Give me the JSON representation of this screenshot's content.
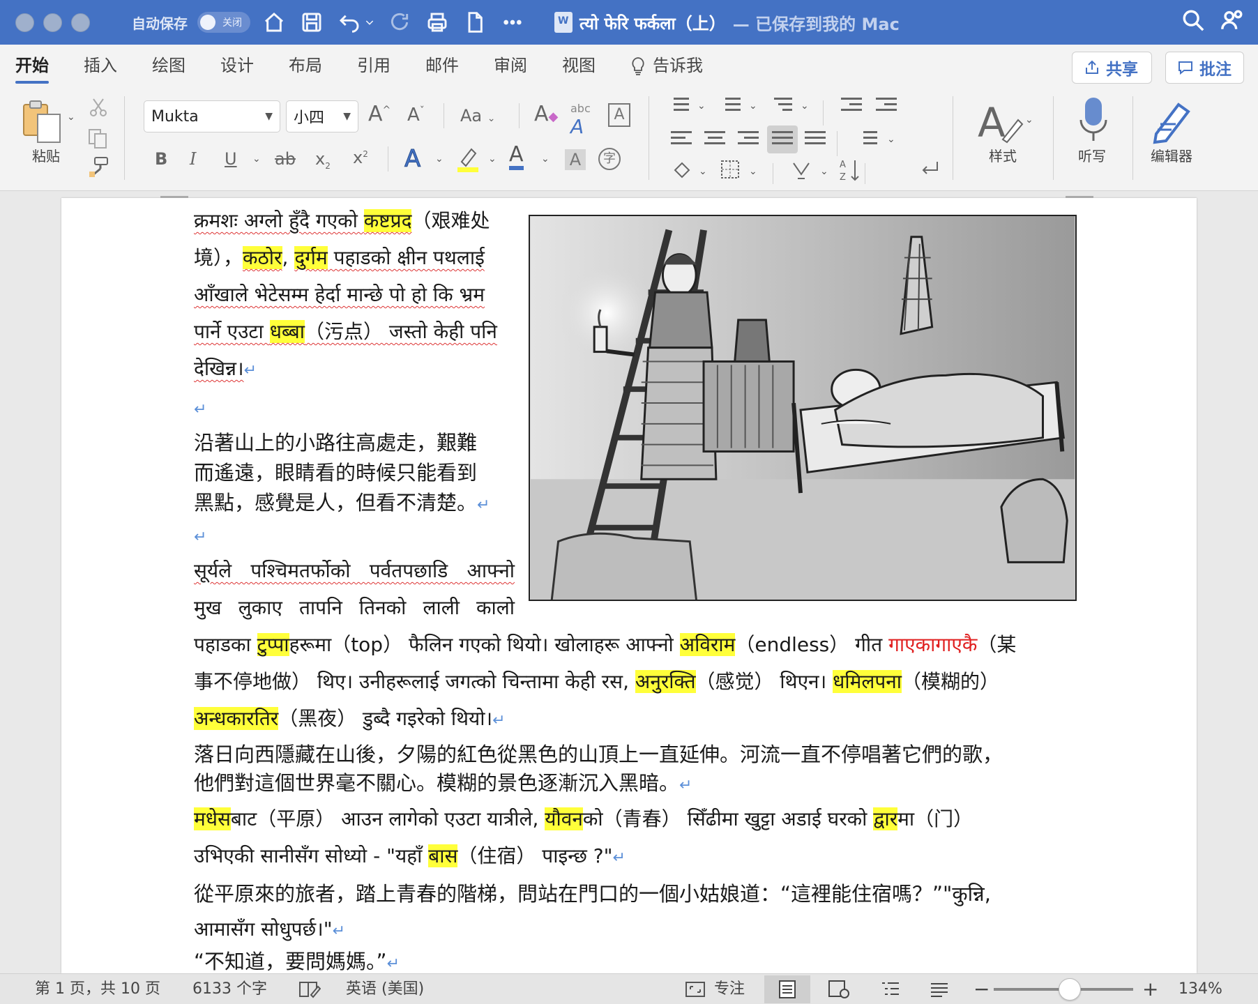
{
  "titlebar": {
    "autosave_label": "自动保存",
    "autosave_state": "关闭",
    "doc_name": "त्यो फेरि फर्कला（上）",
    "saved_status": "— 已保存到我的 Mac"
  },
  "tabs": [
    "开始",
    "插入",
    "绘图",
    "设计",
    "布局",
    "引用",
    "邮件",
    "审阅",
    "视图",
    "告诉我"
  ],
  "share_label": "共享",
  "comments_label": "批注",
  "ribbon": {
    "paste_label": "粘贴",
    "font_name": "Mukta",
    "font_size": "小四",
    "aa_label": "Aa",
    "abc_label": "abc",
    "styles_label": "样式",
    "dictate_label": "听写",
    "editor_label": "编辑器"
  },
  "doc": {
    "p1_l1_a": "क्रमशः अग्लो हुँदै गएको ",
    "p1_l1_hl": "कष्टप्रद",
    "p1_l1_b": "（艰难处",
    "p1_l2_a": "境），",
    "p1_l2_hl1": "कठोर",
    "p1_l2_sep": ", ",
    "p1_l2_hl2": "दुर्गम",
    "p1_l2_b": " पहाडको क्षीन पथलाई",
    "p1_l3": "आँखाले भेटेसम्म हेर्दा मान्छे पो हो कि भ्रम",
    "p1_l4_a": "पार्ने एउटा ",
    "p1_l4_hl": "धब्बा",
    "p1_l4_b": "（污点） जस्तो केही पनि",
    "p1_l5": "देखिन्न।",
    "c1_l1": "沿著山上的小路往高處走，艱難",
    "c1_l2": "而遙遠，眼睛看的時候只能看到",
    "c1_l3": "黑點，感覺是人，但看不清楚。",
    "p2_l1": "सूर्यले पश्चिमतर्फोको पर्वतपछाडि आफ्नो",
    "p2_l2": "मुख लुकाए तापनि तिनको लाली कालो",
    "p2_l3_a": "पहाडका ",
    "p2_l3_hl1": "टुप्पा",
    "p2_l3_b": "हरूमा（top） फैलिन गएको थियो। खोलाहरू आफ्नो ",
    "p2_l3_hl2": "अविराम",
    "p2_l3_c": "（endless） गीत ",
    "p2_l3_red": "गाएकागाएकै",
    "p2_l3_d": "（某",
    "p2_l4_a": "事不停地做） थिए। उनीहरूलाई जगत्को चिन्तामा केही रस, ",
    "p2_l4_hl1": "अनुरक्ति",
    "p2_l4_b": "（感觉） थिएन। ",
    "p2_l4_hl2": "धमिलपना",
    "p2_l4_c": "（模糊的）",
    "p2_l5_hl": "अन्धकारतिर",
    "p2_l5_b": "（黑夜） डुब्दै गइरेको थियो।",
    "c2_l1": "落日向西隱藏在山後，夕陽的紅色從黑色的山頂上一直延伸。河流一直不停唱著它們的歌，",
    "c2_l2": "他們對這個世界毫不關心。模糊的景色逐漸沉入黑暗。",
    "p3_l1_hl1": "मधेस",
    "p3_l1_a": "बाट（平原） आउन लागेको एउटा यात्रीले, ",
    "p3_l1_hl2": "यौवन",
    "p3_l1_b": "को（青春） सिँढीमा खुट्टा अडाई घरको ",
    "p3_l1_hl3": "द्वार",
    "p3_l1_c": "मा（门）",
    "p3_l2_a": "उभिएकी सानीसँग सोध्यो - \"यहाँ ",
    "p3_l2_hl": "बास",
    "p3_l2_b": "（住宿） पाइन्छ ?\"",
    "c3_l1": "從平原來的旅者，踏上青春的階梯，問站在門口的一個小姑娘道：“這裡能住宿嗎？”\"कुन्नि,",
    "c3_l2": "आमासँग सोधुपर्छ।\"",
    "c3_l3": "“不知道，要問媽媽。”"
  },
  "status": {
    "page_info": "第 1 页，共 10 页",
    "word_count": "6133 个字",
    "language": "英语 (美国)",
    "focus_label": "专注",
    "zoom": "134%"
  },
  "colors": {
    "titlebar": "#4472c4",
    "highlight": "#ffff3a",
    "accent": "#4472c4"
  }
}
